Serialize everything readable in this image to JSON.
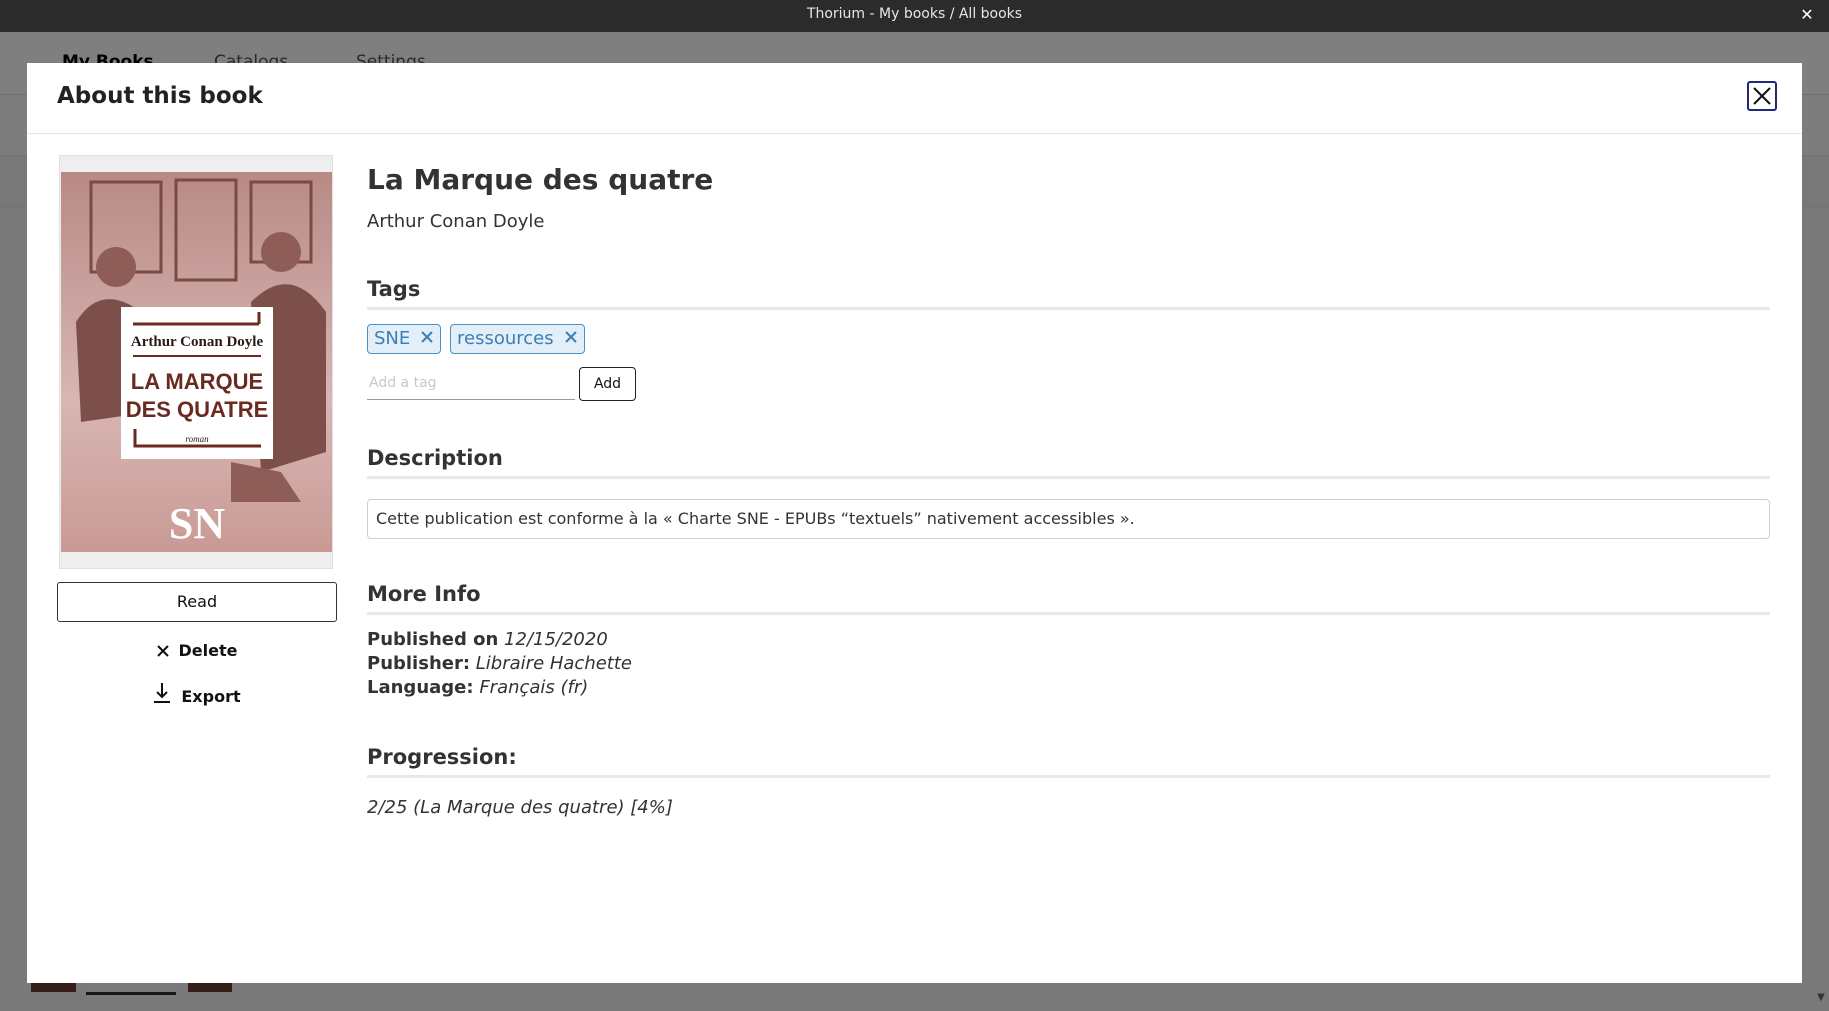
{
  "window": {
    "title": "Thorium - My books / All books",
    "close_glyph": "✕"
  },
  "app_nav": {
    "tabs": [
      "My Books",
      "Catalogs",
      "Settings"
    ]
  },
  "modal": {
    "title": "About this book",
    "close_icon": "close-icon"
  },
  "book": {
    "title": "La Marque des quatre",
    "author": "Arthur Conan Doyle",
    "cover": {
      "author": "Arthur Conan Doyle",
      "title_line1": "LA MARQUE",
      "title_line2": "DES QUATRE",
      "subtitle": "roman",
      "logo": "SN"
    }
  },
  "actions": {
    "read_label": "Read",
    "delete_label": "Delete",
    "export_label": "Export"
  },
  "tags": {
    "heading": "Tags",
    "items": [
      {
        "label": "SNE"
      },
      {
        "label": "ressources"
      }
    ],
    "input_placeholder": "Add a tag",
    "add_label": "Add"
  },
  "description": {
    "heading": "Description",
    "text": "Cette publication est conforme à la « Charte SNE - EPUBs “textuels” nativement accessibles »."
  },
  "more_info": {
    "heading": "More Info",
    "published_label": "Published on",
    "published_value": "12/15/2020",
    "publisher_label": "Publisher:",
    "publisher_value": "Libraire Hachette",
    "language_label": "Language:",
    "language_value": "Français (fr)"
  },
  "progression": {
    "heading": "Progression:",
    "text": "2/25 (La Marque des quatre) [4%]"
  },
  "colors": {
    "accent_border": "#1d2b7a",
    "tag_bg": "#e2eef8",
    "tag_text": "#3a7fb5",
    "cover_red": "#6b2a20"
  }
}
